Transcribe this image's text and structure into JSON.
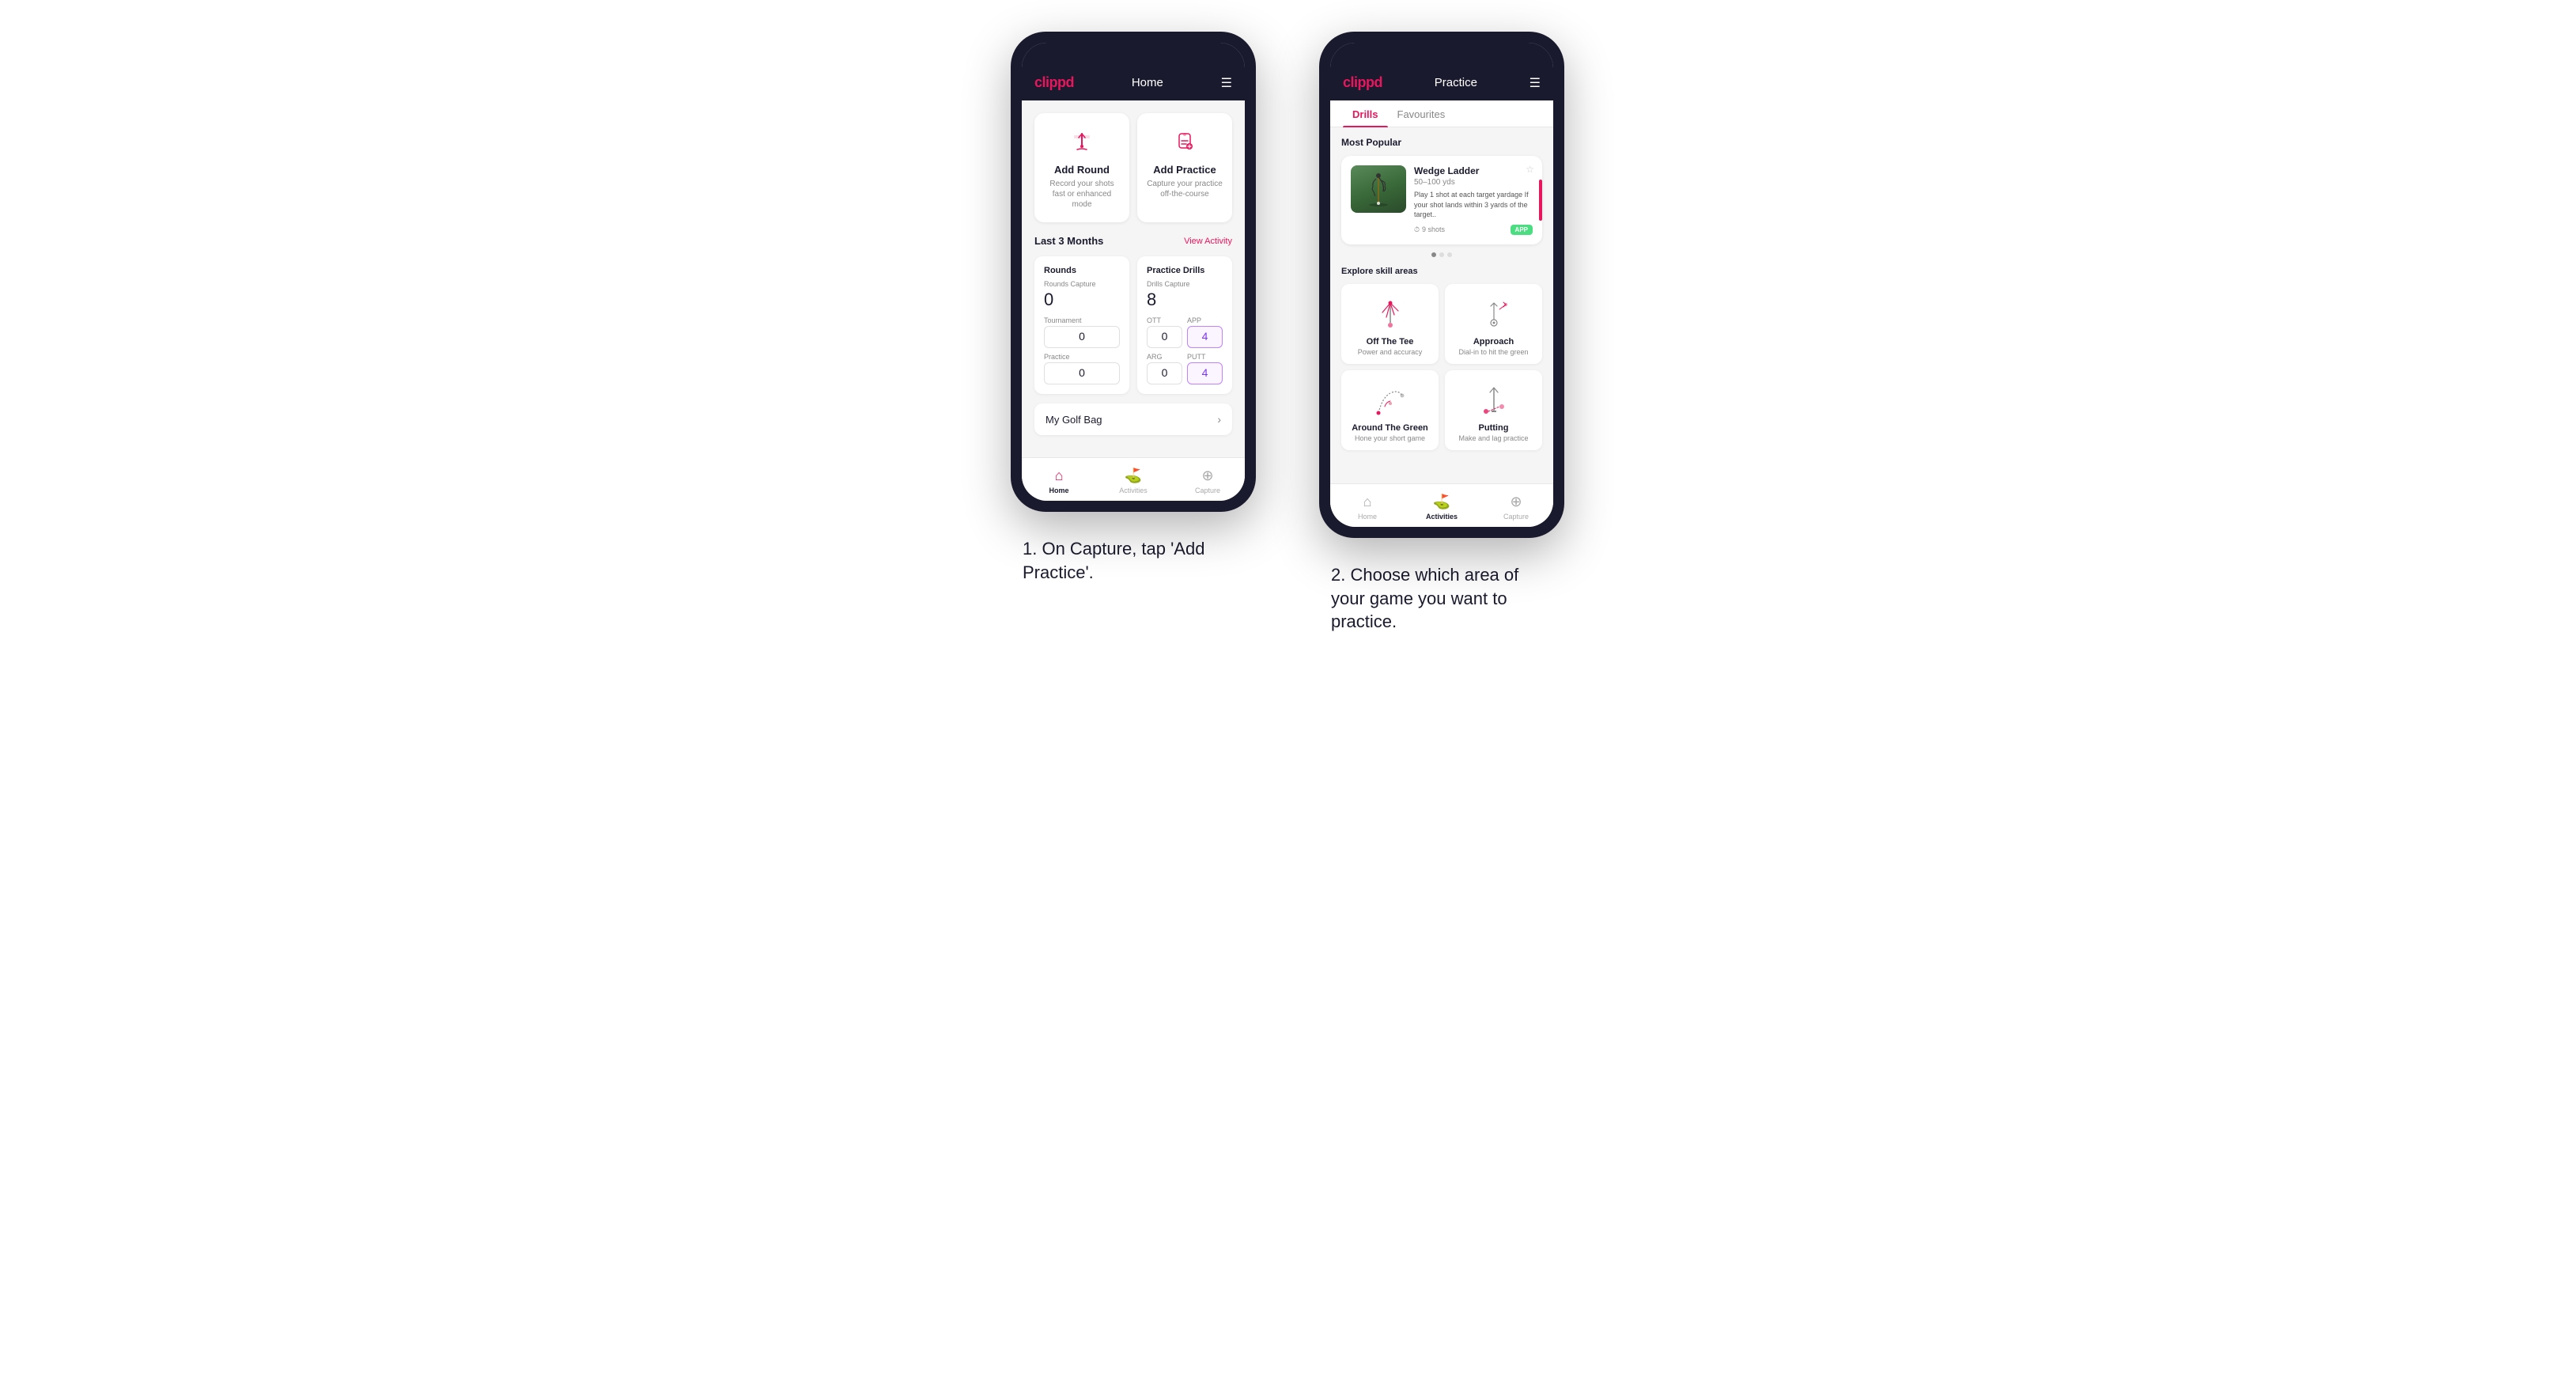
{
  "phone1": {
    "header": {
      "logo": "clippd",
      "title": "Home",
      "menu_icon": "☰"
    },
    "add_round": {
      "title": "Add Round",
      "description": "Record your shots fast or enhanced mode"
    },
    "add_practice": {
      "title": "Add Practice",
      "description": "Capture your practice off-the-course"
    },
    "last_months": {
      "label": "Last 3 Months",
      "view_link": "View Activity"
    },
    "rounds": {
      "section_title": "Rounds",
      "capture_label": "Rounds Capture",
      "capture_value": "0",
      "tournament_label": "Tournament",
      "tournament_value": "0",
      "practice_label": "Practice",
      "practice_value": "0"
    },
    "practice_drills": {
      "section_title": "Practice Drills",
      "capture_label": "Drills Capture",
      "capture_value": "8",
      "ott_label": "OTT",
      "ott_value": "0",
      "app_label": "APP",
      "app_value": "4",
      "arg_label": "ARG",
      "arg_value": "0",
      "putt_label": "PUTT",
      "putt_value": "4"
    },
    "golf_bag": {
      "label": "My Golf Bag"
    },
    "nav": {
      "home": "Home",
      "activities": "Activities",
      "capture": "Capture"
    }
  },
  "phone2": {
    "header": {
      "logo": "clippd",
      "title": "Practice",
      "menu_icon": "☰"
    },
    "tabs": {
      "drills": "Drills",
      "favourites": "Favourites"
    },
    "most_popular": {
      "title": "Most Popular",
      "card": {
        "name": "Wedge Ladder",
        "yardage": "50–100 yds",
        "description": "Play 1 shot at each target yardage If your shot lands within 3 yards of the target..",
        "shots": "9 shots",
        "badge": "APP"
      }
    },
    "explore": {
      "title": "Explore skill areas",
      "skills": [
        {
          "name": "Off The Tee",
          "description": "Power and accuracy"
        },
        {
          "name": "Approach",
          "description": "Dial-in to hit the green"
        },
        {
          "name": "Around The Green",
          "description": "Hone your short game"
        },
        {
          "name": "Putting",
          "description": "Make and lag practice"
        }
      ]
    },
    "nav": {
      "home": "Home",
      "activities": "Activities",
      "capture": "Capture"
    }
  },
  "captions": {
    "caption1": "1. On Capture, tap 'Add Practice'.",
    "caption2": "2. Choose which area of your game you want to practice."
  }
}
